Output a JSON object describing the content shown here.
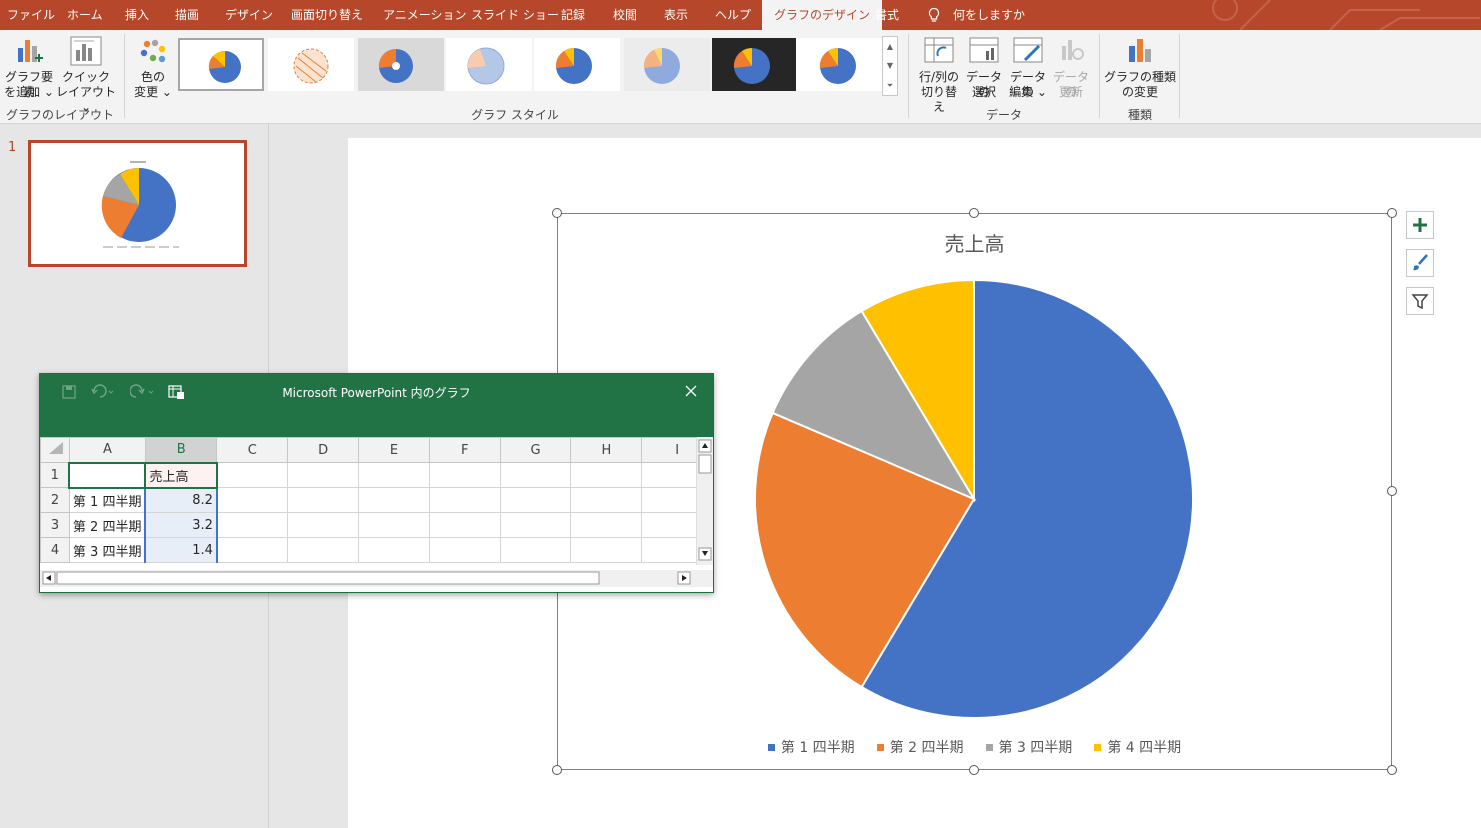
{
  "tabs": [
    {
      "label": "ファイル",
      "active": false
    },
    {
      "label": "ホーム",
      "active": false
    },
    {
      "label": "挿入",
      "active": false
    },
    {
      "label": "描画",
      "active": false
    },
    {
      "label": "デザイン",
      "active": false
    },
    {
      "label": "画面切り替え",
      "active": false
    },
    {
      "label": "アニメーション",
      "active": false
    },
    {
      "label": "スライド ショー",
      "active": false
    },
    {
      "label": "記録",
      "active": false
    },
    {
      "label": "校閲",
      "active": false
    },
    {
      "label": "表示",
      "active": false
    },
    {
      "label": "ヘルプ",
      "active": false
    },
    {
      "label": "グラフのデザイン",
      "active": true
    },
    {
      "label": "書式",
      "active": false
    }
  ],
  "tell_me": "何をしますか",
  "ribbon": {
    "add_element": {
      "line1": "グラフ要素",
      "line2": "を追加 ⌄"
    },
    "quick_layout": {
      "line1": "クイック",
      "line2": "レイアウト ⌄"
    },
    "change_colors": {
      "line1": "色の",
      "line2": "変更 ⌄"
    },
    "switch_row_col": {
      "line1": "行/列の",
      "line2": "切り替え"
    },
    "select_data": {
      "line1": "データの",
      "line2": "選択"
    },
    "edit_data": {
      "line1": "データの",
      "line2": "編集 ⌄"
    },
    "refresh_data": {
      "line1": "データの",
      "line2": "更新"
    },
    "change_type": {
      "line1": "グラフの種類",
      "line2": "の変更"
    },
    "group_layout": "グラフのレイアウト",
    "group_styles": "グラフ スタイル",
    "group_data": "データ",
    "group_type": "種類"
  },
  "slide_number": "1",
  "excel": {
    "title": "Microsoft PowerPoint 内のグラフ",
    "col_headers": [
      "A",
      "B",
      "C",
      "D",
      "E",
      "F",
      "G",
      "H",
      "I"
    ],
    "rows": [
      {
        "num": "1",
        "a": "",
        "b": "売上高"
      },
      {
        "num": "2",
        "a": "第 1 四半期",
        "b": "8.2"
      },
      {
        "num": "3",
        "a": "第 2 四半期",
        "b": "3.2"
      },
      {
        "num": "4",
        "a": "第 3 四半期",
        "b": "1.4"
      }
    ]
  },
  "chart_data": {
    "type": "pie",
    "title": "売上高",
    "categories": [
      "第 1 四半期",
      "第 2 四半期",
      "第 3 四半期",
      "第 4 四半期"
    ],
    "values": [
      8.2,
      3.2,
      1.4,
      1.2
    ],
    "colors": [
      "#4472c4",
      "#ed7d31",
      "#a5a5a5",
      "#ffc000"
    ],
    "legend_position": "bottom"
  },
  "colors": {
    "accent": "#b7472a",
    "excel_green": "#217346"
  }
}
